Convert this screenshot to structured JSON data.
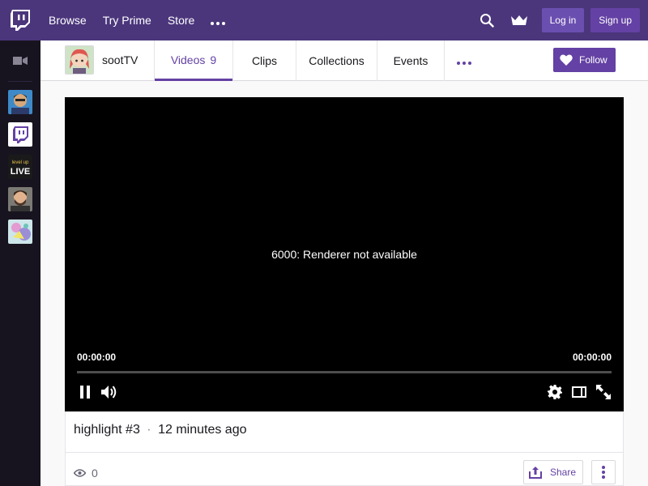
{
  "topnav": {
    "logo_icon": "twitch-glitch-icon",
    "links": [
      "Browse",
      "Try Prime",
      "Store"
    ],
    "more_icon": "more-dots-icon",
    "search_icon": "search-icon",
    "prime_icon": "crown-icon",
    "login_label": "Log in",
    "signup_label": "Sign up",
    "bg_color": "#4b367c"
  },
  "sidebar": {
    "camera_icon": "video-camera-icon",
    "channels": [
      "channel-avatar-1",
      "channel-avatar-twitch",
      "channel-avatar-levelup",
      "channel-avatar-4",
      "channel-avatar-5"
    ],
    "levelup_text": [
      "level up",
      "LIVE"
    ]
  },
  "channel": {
    "name": "sootTV",
    "tabs": [
      {
        "label": "Videos",
        "count": "9"
      },
      {
        "label": "Clips"
      },
      {
        "label": "Collections"
      },
      {
        "label": "Events"
      }
    ],
    "follow_label": "Follow",
    "accent": "#6441a4"
  },
  "player": {
    "error": "6000: Renderer not available",
    "time_current": "00:00:00",
    "time_total": "00:00:00",
    "progress": 0
  },
  "video": {
    "title": "highlight #3",
    "separator": "·",
    "age": "12 minutes ago",
    "views": "0",
    "share_label": "Share"
  }
}
